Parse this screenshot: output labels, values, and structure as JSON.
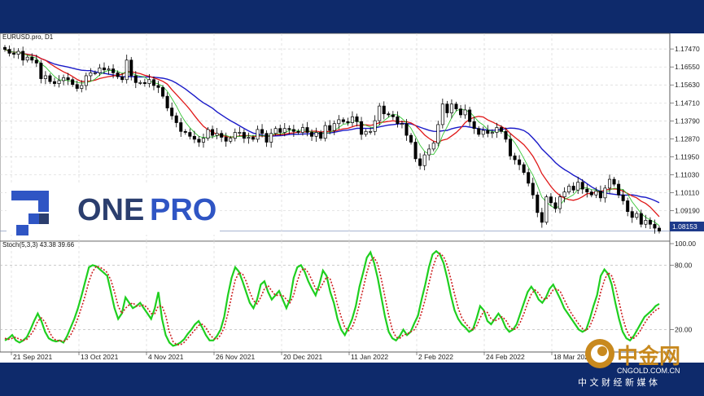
{
  "chart_data": [
    {
      "type": "candlestick",
      "title": "EURUSD.pro, D1",
      "price_ticks": [
        "1.17470",
        "1.16550",
        "1.15630",
        "1.14710",
        "1.13790",
        "1.12870",
        "1.11950",
        "1.11030",
        "1.10110",
        "1.09190",
        "1.08153"
      ],
      "current_price": "1.08153",
      "x_ticks": [
        "21 Sep 2021",
        "13 Oct 2021",
        "4 Nov 2021",
        "26 Nov 2021",
        "20 Dec 2021",
        "11 Jan 2022",
        "2 Feb 2022",
        "24 Feb 2022",
        "18 Mar 2022"
      ],
      "ylim": [
        1.078,
        1.181
      ],
      "close": [
        1.1745,
        1.1725,
        1.172,
        1.1735,
        1.169,
        1.1705,
        1.169,
        1.1675,
        1.1595,
        1.161,
        1.158,
        1.157,
        1.1585,
        1.16,
        1.159,
        1.1565,
        1.1545,
        1.156,
        1.161,
        1.1625,
        1.1625,
        1.165,
        1.164,
        1.1645,
        1.1625,
        1.1605,
        1.159,
        1.169,
        1.161,
        1.1575,
        1.1575,
        1.157,
        1.159,
        1.156,
        1.155,
        1.1505,
        1.1445,
        1.1405,
        1.137,
        1.1325,
        1.132,
        1.13,
        1.1285,
        1.127,
        1.129,
        1.1335,
        1.1305,
        1.1315,
        1.1295,
        1.1275,
        1.129,
        1.132,
        1.132,
        1.129,
        1.1295,
        1.1285,
        1.1335,
        1.1315,
        1.127,
        1.1315,
        1.134,
        1.132,
        1.134,
        1.1335,
        1.1325,
        1.132,
        1.1345,
        1.132,
        1.13,
        1.132,
        1.129,
        1.1355,
        1.133,
        1.1365,
        1.1385,
        1.1375,
        1.137,
        1.14,
        1.1375,
        1.131,
        1.1325,
        1.1325,
        1.138,
        1.1455,
        1.1415,
        1.141,
        1.14,
        1.1365,
        1.1365,
        1.1305,
        1.127,
        1.1185,
        1.115,
        1.1205,
        1.1235,
        1.1265,
        1.136,
        1.1465,
        1.142,
        1.1465,
        1.144,
        1.141,
        1.1435,
        1.1375,
        1.134,
        1.131,
        1.133,
        1.1315,
        1.132,
        1.1345,
        1.1325,
        1.1285,
        1.12,
        1.118,
        1.1155,
        1.1115,
        1.106,
        1.1,
        1.091,
        1.086,
        1.099,
        1.096,
        1.093,
        1.099,
        1.1015,
        1.1045,
        1.1025,
        1.1065,
        1.103,
        1.1015,
        1.1,
        1.102,
        1.0985,
        1.1035,
        1.108,
        1.1055,
        1.1,
        1.097,
        1.0915,
        1.0885,
        1.0905,
        1.085,
        1.087,
        1.085,
        1.083,
        1.0815
      ],
      "overlays": [
        "fast MA (green)",
        "medium MA (red)",
        "slow MA (blue)"
      ],
      "current_price_line": 1.08153
    },
    {
      "type": "line",
      "title": "Stoch(5,3,3) 43.38 39.66",
      "ticks": [
        "100.00",
        "80.00",
        "20.00"
      ],
      "ylim": [
        0,
        100
      ],
      "levels": [
        80,
        20
      ],
      "series": [
        {
          "color": "#1fcf1f",
          "values": [
            10,
            12,
            15,
            10,
            8,
            10,
            13,
            20,
            28,
            35,
            28,
            18,
            12,
            10,
            9,
            10,
            8,
            14,
            22,
            30,
            40,
            52,
            65,
            78,
            80,
            79,
            76,
            73,
            70,
            55,
            40,
            30,
            35,
            50,
            45,
            40,
            42,
            45,
            40,
            35,
            30,
            40,
            55,
            30,
            15,
            8,
            5,
            6,
            8,
            11,
            16,
            20,
            25,
            28,
            22,
            15,
            10,
            10,
            14,
            20,
            32,
            52,
            68,
            78,
            74,
            65,
            55,
            45,
            40,
            48,
            62,
            65,
            55,
            48,
            52,
            56,
            48,
            40,
            48,
            68,
            78,
            80,
            74,
            65,
            58,
            52,
            62,
            75,
            70,
            55,
            45,
            30,
            20,
            15,
            22,
            30,
            42,
            60,
            73,
            87,
            92,
            82,
            68,
            50,
            32,
            18,
            12,
            10,
            14,
            20,
            15,
            18,
            26,
            33,
            48,
            62,
            78,
            90,
            93,
            90,
            82,
            68,
            52,
            38,
            30,
            25,
            22,
            18,
            20,
            30,
            42,
            38,
            28,
            25,
            30,
            35,
            30,
            22,
            18,
            20,
            25,
            35,
            45,
            55,
            60,
            55,
            48,
            45,
            50,
            58,
            62,
            55,
            48,
            40,
            35,
            30,
            25,
            20,
            18,
            20,
            30,
            42,
            52,
            70,
            76,
            72,
            62,
            45,
            30,
            18,
            12,
            10,
            14,
            20,
            26,
            32,
            35,
            38,
            42,
            44
          ]
        },
        {
          "color": "#cc1f1f",
          "dash": true,
          "values": [
            12,
            11,
            12,
            13,
            11,
            10,
            11,
            15,
            20,
            28,
            31,
            27,
            19,
            13,
            10,
            10,
            9,
            11,
            15,
            22,
            31,
            41,
            52,
            65,
            74,
            79,
            78,
            76,
            73,
            66,
            55,
            42,
            35,
            40,
            43,
            45,
            42,
            42,
            43,
            40,
            35,
            35,
            42,
            42,
            33,
            18,
            9,
            6,
            6,
            8,
            12,
            16,
            20,
            24,
            25,
            22,
            16,
            12,
            11,
            15,
            22,
            35,
            51,
            66,
            73,
            72,
            65,
            55,
            47,
            44,
            50,
            58,
            61,
            56,
            52,
            52,
            52,
            48,
            45,
            52,
            65,
            75,
            77,
            73,
            66,
            58,
            57,
            63,
            69,
            67,
            57,
            43,
            32,
            22,
            19,
            22,
            31,
            44,
            58,
            73,
            84,
            87,
            81,
            67,
            50,
            33,
            20,
            13,
            12,
            15,
            16,
            18,
            20,
            26,
            36,
            48,
            63,
            77,
            87,
            91,
            88,
            80,
            67,
            53,
            40,
            31,
            26,
            22,
            20,
            23,
            31,
            37,
            36,
            30,
            28,
            30,
            32,
            29,
            23,
            20,
            21,
            27,
            35,
            45,
            53,
            57,
            54,
            49,
            48,
            52,
            57,
            58,
            55,
            48,
            41,
            35,
            30,
            25,
            21,
            19,
            23,
            31,
            41,
            55,
            66,
            73,
            70,
            60,
            46,
            31,
            20,
            13,
            12,
            15,
            20,
            26,
            31,
            35,
            38,
            40
          ]
        }
      ]
    }
  ],
  "branding": {
    "logo_text_one": "ONE",
    "logo_text_pro": "PRO",
    "watermark_cn": "中金网",
    "watermark_domain": "CNGOLD.COM.CN",
    "watermark_sub": "中 文 财 经 新 媒 体"
  },
  "colors": {
    "frame": "#0e2a6b",
    "bull": "#ffffff",
    "bear": "#000000",
    "ma_fast": "#35c535",
    "ma_mid": "#e01818",
    "ma_slow": "#1a1ac8",
    "stoch_k": "#1fcf1f",
    "stoch_d": "#cc1f1f",
    "logo_blue": "#2f55c4",
    "logo_dark": "#2b3e6e",
    "watermark_gold": "#c8891e"
  }
}
